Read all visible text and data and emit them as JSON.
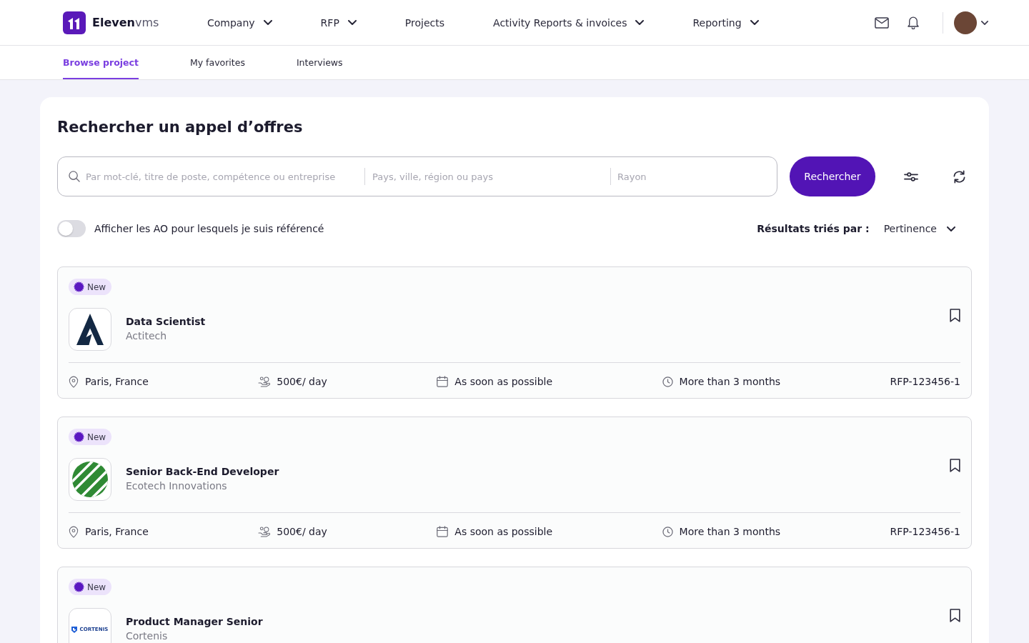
{
  "topbar": {
    "logo": "**Eleven**vms",
    "nav": [
      {
        "label": "Company",
        "has_menu": true
      },
      {
        "label": "RFP",
        "has_menu": true
      },
      {
        "label": "Projects",
        "has_menu": false
      },
      {
        "label": "Activity Reports & invoices",
        "has_menu": true
      },
      {
        "label": "Reporting",
        "has_menu": true
      }
    ]
  },
  "subtabs": [
    {
      "label": "Browse project",
      "selected": true
    },
    {
      "label": "My favorites",
      "selected": false
    },
    {
      "label": "Interviews",
      "selected": false
    }
  ],
  "search": {
    "title": "Rechercher un appel d’offres",
    "keyword_placeholder": "Par mot-clé, titre de poste, compétence ou entreprise",
    "location_placeholder": "Pays, ville, région ou pays",
    "radius_placeholder": "Rayon",
    "submit": "Rechercher"
  },
  "referenced_toggle": {
    "label": "Afficher les AO pour lesquels je suis référencé",
    "on": false
  },
  "sort": {
    "label": "Résultats triés par :",
    "value": "Pertinence"
  },
  "projects": [
    {
      "badge": "New",
      "title": "Data Scientist",
      "company": "Actitech",
      "logo": {
        "kind": "peak"
      },
      "bookmarked": false,
      "location": "Paris, France",
      "rate": "500€/ day",
      "start": "As soon as possible",
      "duration": "More than 3 months",
      "reference": "RFP-123456-1"
    },
    {
      "badge": "New",
      "title": "Senior Back-End Developer",
      "company": "Ecotech Innovations",
      "logo": {
        "kind": "stripes"
      },
      "bookmarked": false,
      "location": "Paris, France",
      "rate": "500€/ day",
      "start": "As soon as possible",
      "duration": "More than 3 months",
      "reference": "RFP-123456-1"
    },
    {
      "badge": "New",
      "title": "Product Manager Senior",
      "company": "Cortenis",
      "logo": {
        "kind": "wordmark",
        "text": "CORTENIS"
      },
      "bookmarked": false
    }
  ]
}
